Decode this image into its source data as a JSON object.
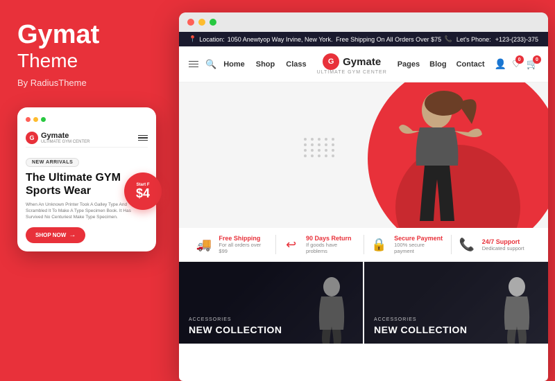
{
  "left_panel": {
    "brand_name": "Gymat",
    "brand_tagline": "Theme",
    "brand_by": "By RadiusTheme"
  },
  "mobile_mockup": {
    "badge": "NEW ARRIVALS",
    "hero_title": "The Ultimate GYM Sports Wear",
    "hero_text": "When An Unknown Printer Took A Galley Type And Scrambled It To Make A Type Specimen Book. It Has Survived No Centuriest Make Type Specimen.",
    "promo_start": "Start F",
    "promo_price": "$4",
    "shop_btn": "SHOP NOW"
  },
  "browser": {
    "topbar": {
      "location_label": "Location:",
      "location_address": "1050 Anewtyop Way Irvine, New York.",
      "shipping_text": "Free Shipping On All Orders Over $75",
      "phone_label": "Let's Phone:",
      "phone_number": "+123-(233)-375"
    },
    "nav": {
      "links_left": [
        "Home",
        "Shop",
        "Class"
      ],
      "logo_text": "Gymate",
      "logo_subtitle": "ULTIMATE GYM CENTER",
      "links_right": [
        "Pages",
        "Blog",
        "Contact"
      ]
    },
    "features": [
      {
        "title": "Free Shipping",
        "desc": "For all orders over $99",
        "icon": "🚚"
      },
      {
        "title": "90 Days Return",
        "desc": "If goods have problems",
        "icon": "↩"
      },
      {
        "title": "Secure Payment",
        "desc": "100% secure payment",
        "icon": "🔒"
      },
      {
        "title": "24/7 Support",
        "desc": "Dedicated support",
        "icon": "📞"
      }
    ],
    "products": [
      {
        "category": "ACCESSORIES",
        "title": "NEW COLLECTION"
      },
      {
        "category": "ACCESSORIES",
        "title": "NEW COLLECTION"
      }
    ]
  }
}
